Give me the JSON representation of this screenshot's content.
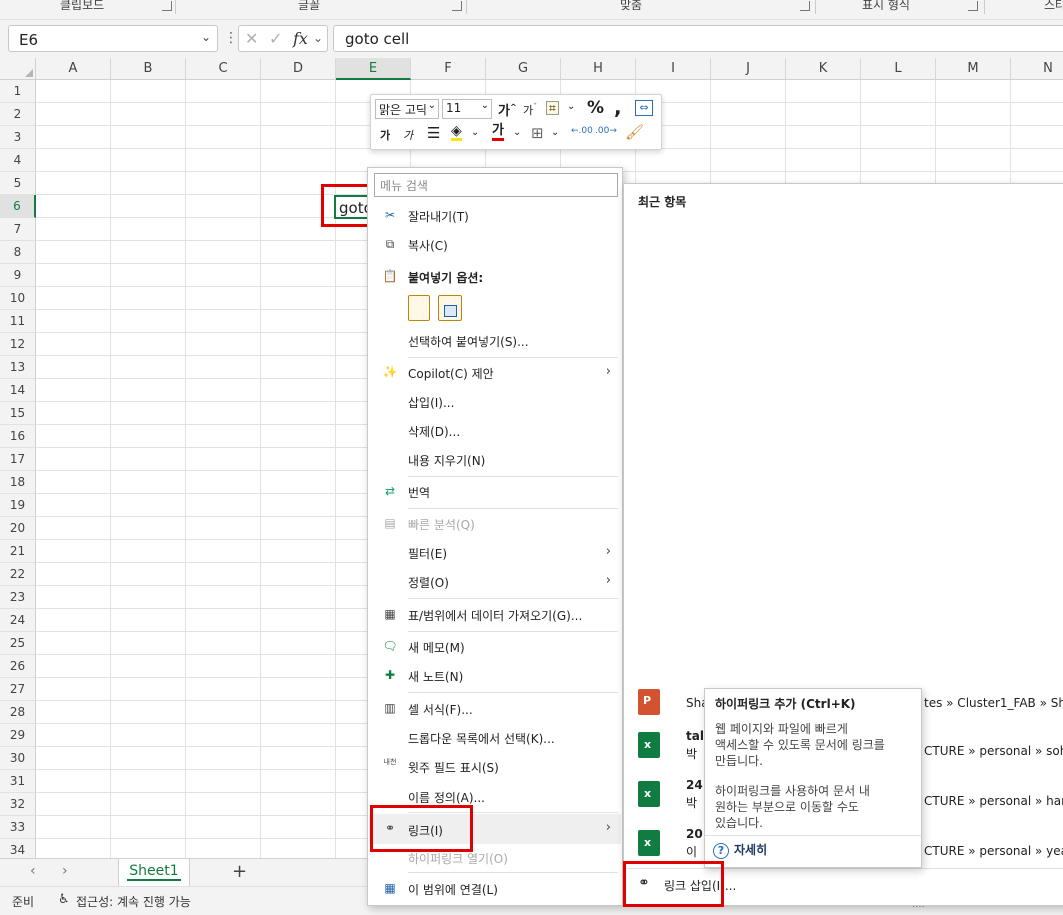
{
  "ribbon": {
    "groups": [
      "클립보드",
      "글꼴",
      "맞춤",
      "표시 형식",
      "스타"
    ]
  },
  "formula_bar": {
    "name_box": "E6",
    "fx": "fx",
    "formula": "goto cell"
  },
  "grid": {
    "columns": [
      "A",
      "B",
      "C",
      "D",
      "E",
      "F",
      "G",
      "H",
      "I",
      "J",
      "K",
      "L",
      "M",
      "N"
    ],
    "selected_column": "E",
    "rows": [
      "1",
      "2",
      "3",
      "4",
      "5",
      "6",
      "7",
      "8",
      "9",
      "10",
      "11",
      "12",
      "13",
      "14",
      "15",
      "16",
      "17",
      "18",
      "19",
      "20",
      "21",
      "22",
      "23",
      "24",
      "25",
      "26",
      "27",
      "28",
      "29",
      "30",
      "31",
      "32",
      "33",
      "34"
    ],
    "selected_row": "6",
    "active_cell_text": "goto cell"
  },
  "mini_toolbar": {
    "font_name": "맑은 고딕",
    "font_size": "11",
    "grow_font": "가",
    "shrink_font": "가",
    "bold": "가",
    "italic": "가",
    "font_color": "가",
    "percent": "%",
    "comma": ",",
    "decrease_decimal": ".00",
    "increase_decimal": ".00"
  },
  "context_menu": {
    "search_placeholder": "메뉴 검색",
    "cut": "잘라내기(T)",
    "copy": "복사(C)",
    "paste_options": "붙여넣기 옵션:",
    "paste_special": "선택하여 붙여넣기(S)...",
    "copilot": "Copilot(C) 제안",
    "insert": "삽입(I)...",
    "delete": "삭제(D)...",
    "clear_contents": "내용 지우기(N)",
    "translate": "번역",
    "quick_analysis": "빠른 분석(Q)",
    "filter": "필터(E)",
    "sort": "정렬(O)",
    "get_data": "표/범위에서 데이터 가져오기(G)...",
    "new_comment": "새 메모(M)",
    "new_note": "새 노트(N)",
    "format_cells": "셀 서식(F)...",
    "pick_from_list": "드롭다운 목록에서 선택(K)...",
    "phonetic": "윗주 필드 표시(S)",
    "phonetic_icon": "내천",
    "define_name": "이름 정의(A)...",
    "link": "링크(I)",
    "open_hyperlink": "하이퍼링크 열기(O)",
    "link_to_range": "이 범위에 연결(L)"
  },
  "submenu": {
    "recent_header": "최근 항목",
    "recent_files": [
      {
        "name": "Sha",
        "path": "tes » Cluster1_FAB » Sha"
      },
      {
        "name": "tal",
        "sub": "박",
        "path": "CTURE » personal » sohy"
      },
      {
        "name": "24",
        "sub": "박",
        "path": "CTURE » personal » hank"
      },
      {
        "name": "20",
        "sub": "이",
        "path": "CTURE » personal » yeac"
      }
    ],
    "insert_link": "링크 삽입(I)..."
  },
  "tooltip": {
    "title": "하이퍼링크 추가 (Ctrl+K)",
    "para1_lines": [
      "웹 페이지와 파일에 빠르게",
      "액세스할 수 있도록 문서에 링크를",
      "만듭니다."
    ],
    "para2_lines": [
      "하이퍼링크를 사용하여 문서 내",
      "원하는 부분으로 이동할 수도",
      "있습니다."
    ],
    "more": "자세히"
  },
  "sheet_tabs": {
    "tab": "Sheet1",
    "add": "+"
  },
  "status_bar": {
    "ready": "준비",
    "accessibility": "접근성: 계속 진행 가능"
  },
  "colors": {
    "excel_green": "#107c41",
    "highlight_red": "#e00000",
    "font_red": "#e00000",
    "fill_yellow": "#ffe600"
  }
}
